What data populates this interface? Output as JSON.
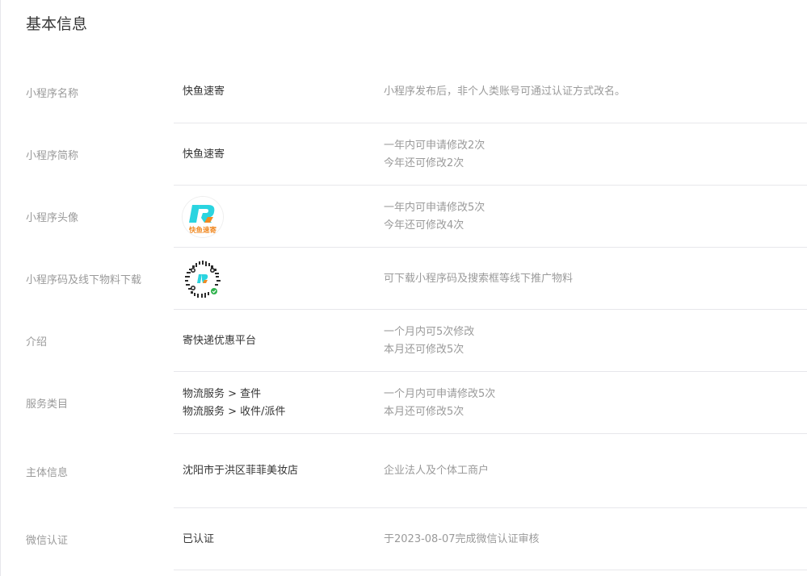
{
  "section": {
    "title": "基本信息"
  },
  "rows": {
    "name": {
      "label": "小程序名称",
      "value": "快鱼速寄",
      "tip": "小程序发布后，非个人类账号可通过认证方式改名。"
    },
    "short_name": {
      "label": "小程序简称",
      "value": "快鱼速寄",
      "tip_1": "一年内可申请修改2次",
      "tip_2": "今年还可修改2次"
    },
    "avatar": {
      "label": "小程序头像",
      "logo_text": "快鱼速寄",
      "tip_1": "一年内可申请修改5次",
      "tip_2": "今年还可修改4次"
    },
    "qrcode": {
      "label": "小程序码及线下物料下载",
      "tip": "可下载小程序码及搜索框等线下推广物料"
    },
    "intro": {
      "label": "介绍",
      "value": "寄快递优惠平台",
      "tip_1": "一个月内可5次修改",
      "tip_2": "本月还可修改5次"
    },
    "category": {
      "label": "服务类目",
      "value_1": "物流服务 > 查件",
      "value_2": "物流服务 > 收件/派件",
      "tip_1": "一个月内可申请修改5次",
      "tip_2": "本月还可修改5次"
    },
    "subject": {
      "label": "主体信息",
      "value": "沈阳市于洪区菲菲美妆店",
      "tip": "企业法人及个体工商户"
    },
    "wechat_auth": {
      "label": "微信认证",
      "value": "已认证",
      "tip": "于2023-08-07完成微信认证审核"
    }
  },
  "colors": {
    "logo_cyan": "#2ad4e0",
    "logo_orange": "#f08a24",
    "qr_green": "#2fb24c",
    "divider": "#e7e7eb",
    "label_gray": "#9a9a9a",
    "text_dark": "#353535"
  },
  "icons": {
    "avatar": "app-logo-icon",
    "qrcode": "mini-program-code-icon"
  }
}
